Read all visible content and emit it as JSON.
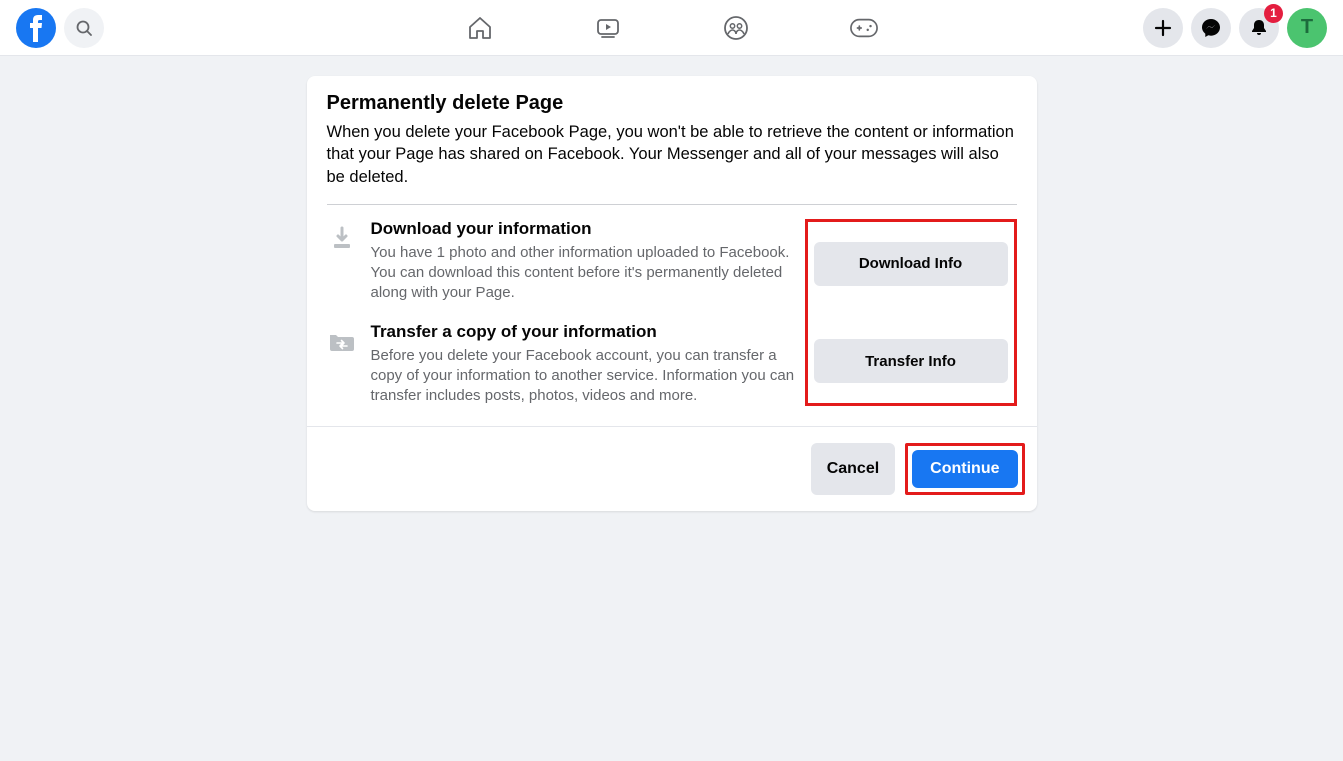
{
  "header": {
    "notification_count": "1",
    "avatar_initial": "T"
  },
  "card": {
    "title": "Permanently delete Page",
    "description": "When you delete your Facebook Page, you won't be able to retrieve the content or information that your Page has shared on Facebook. Your Messenger and all of your messages will also be deleted.",
    "sections": [
      {
        "title": "Download your information",
        "description": "You have 1 photo and other information uploaded to Facebook. You can download this content before it's permanently deleted along with your Page.",
        "button": "Download Info"
      },
      {
        "title": "Transfer a copy of your information",
        "description": "Before you delete your Facebook account, you can transfer a copy of your information to another service. Information you can transfer includes posts, photos, videos and more.",
        "button": "Transfer Info"
      }
    ],
    "footer": {
      "cancel": "Cancel",
      "continue": "Continue"
    }
  }
}
